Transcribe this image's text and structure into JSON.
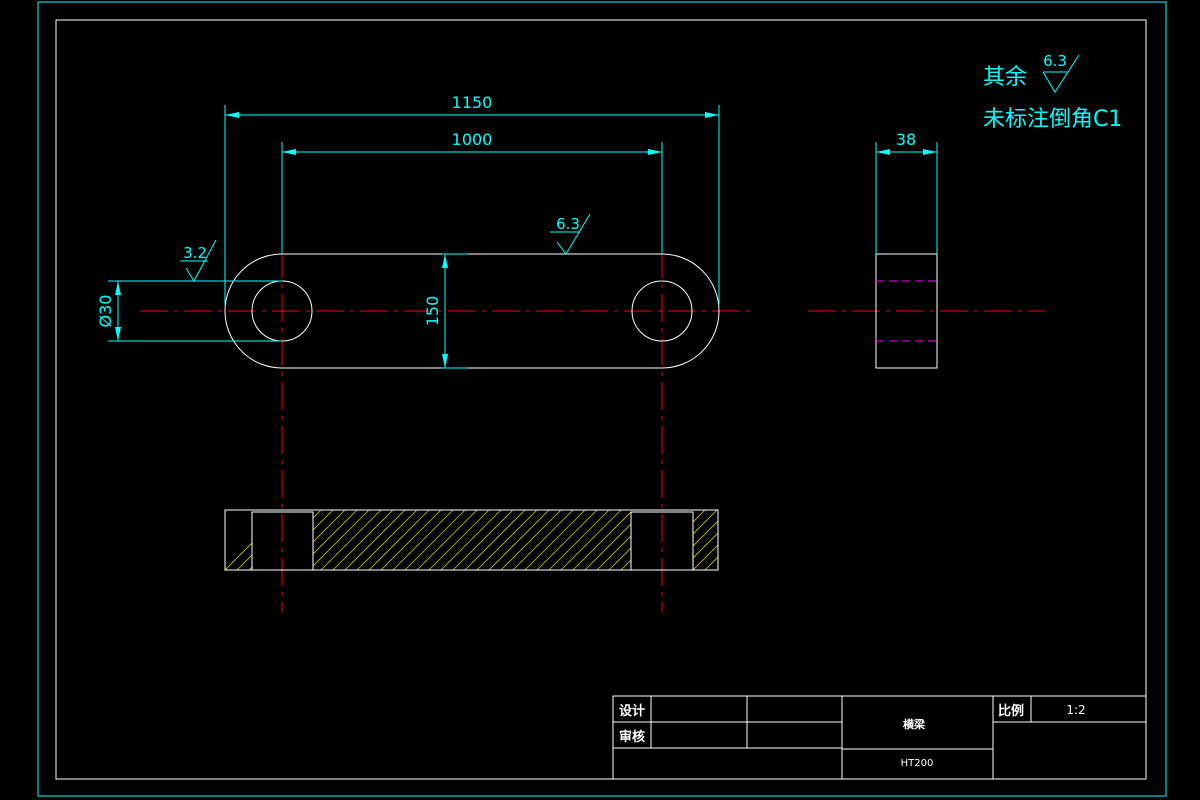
{
  "notes": {
    "remaining_label": "其余",
    "remaining_roughness": "6.3",
    "chamfer_note": "未标注倒角C1"
  },
  "dimensions": {
    "overall_length": "1150",
    "center_distance": "1000",
    "height": "150",
    "hole_diameter": "Ø30",
    "thickness": "38"
  },
  "roughness": {
    "top_surface": "6.3",
    "hole_surface": "3.2"
  },
  "title_block": {
    "design_label": "设计",
    "review_label": "审核",
    "part_name": "横梁",
    "scale_label": "比例",
    "scale_value": "1:2",
    "material": "HT200"
  },
  "colors": {
    "background": "#000000",
    "frame": "#00ffff",
    "outline": "#ffffff",
    "centerline": "#ff0000",
    "dimension": "#00ffff",
    "hatch": "#ffff00",
    "hidden": "#ff00ff"
  }
}
